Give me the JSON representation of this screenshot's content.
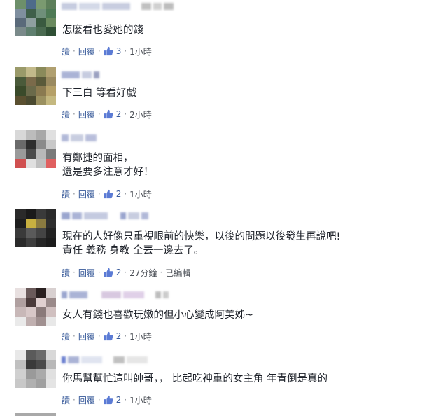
{
  "ui": {
    "reply_label": "讀",
    "respond_label": "回覆",
    "edited_label": "已編輯"
  },
  "comments": [
    {
      "text_lines": [
        "怎麼看也愛她的錢"
      ],
      "likes": "3",
      "time": "1小時"
    },
    {
      "text_lines": [
        "下三白 等看好戲"
      ],
      "likes": "2",
      "time": "2小時"
    },
    {
      "text_lines": [
        "有鄭捷的面相，",
        "還是要多注意才好！"
      ],
      "likes": "2",
      "time": "1小時"
    },
    {
      "text_lines": [
        "現在的人好像只重視眼前的快樂，以後的問題以後發生再說吧!",
        "責任 義務 身教 全丟一邊去了。"
      ],
      "likes": "2",
      "time": "27分鐘"
    },
    {
      "text_lines": [
        "女人有錢也喜歡玩嫩的但小心變成阿美姊~"
      ],
      "likes": "2",
      "time": "1小時"
    },
    {
      "text_lines": [
        "你馬幫幫忙這叫帥哥，，  比起吃神重的女主角 年青倒是真的"
      ],
      "likes": "2",
      "time": "1小時"
    }
  ],
  "colors": {
    "link": "#365899",
    "text": "#1d2129",
    "meta": "#4b4f56"
  }
}
